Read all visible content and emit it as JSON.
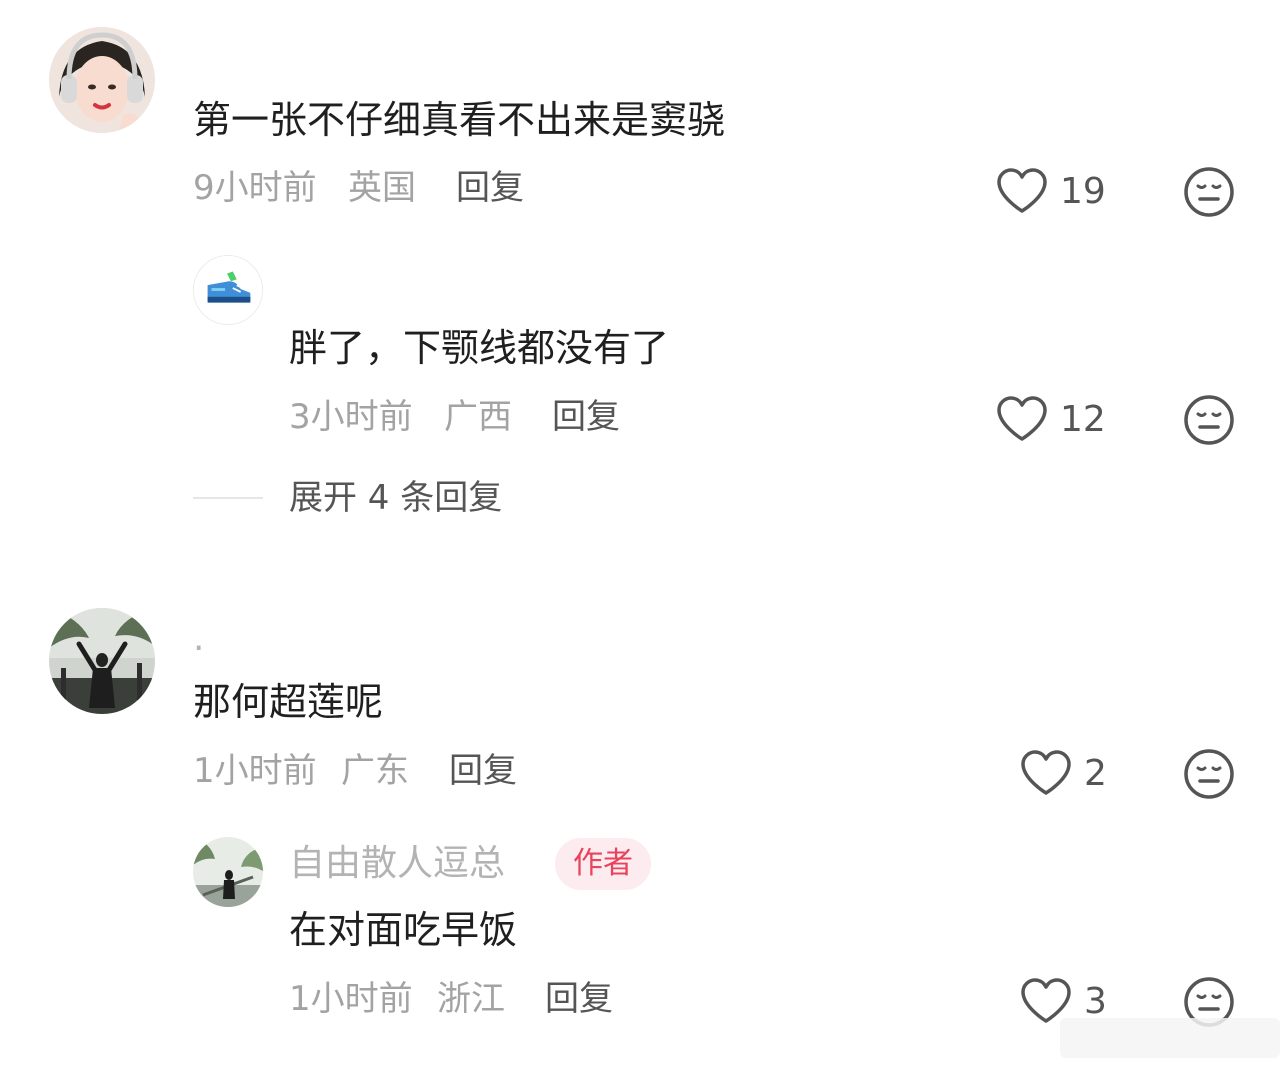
{
  "comments": [
    {
      "text": "第一张不仔细真看不出来是窦骁",
      "time": "9小时前",
      "location": "英国",
      "reply_label": "回复",
      "likes": "19",
      "replies": [
        {
          "text": "胖了，下颚线都没有了",
          "time": "3小时前",
          "location": "广西",
          "reply_label": "回复",
          "likes": "12"
        }
      ],
      "expand_label": "展开 4 条回复"
    },
    {
      "username": "·",
      "text": "那何超莲呢",
      "time": "1小时前",
      "location": "广东",
      "reply_label": "回复",
      "likes": "2",
      "replies": [
        {
          "username": "自由散人逗总",
          "badge": "作者",
          "text": "在对面吃早饭",
          "time": "1小时前",
          "location": "浙江",
          "reply_label": "回复",
          "likes": "3"
        }
      ]
    }
  ],
  "icons": {
    "like": "heart-outline-icon",
    "dislike": "meh-face-icon"
  },
  "colors": {
    "badge_bg": "#fdecef",
    "badge_text": "#e8435d",
    "meta_text": "#a3a3a3"
  }
}
